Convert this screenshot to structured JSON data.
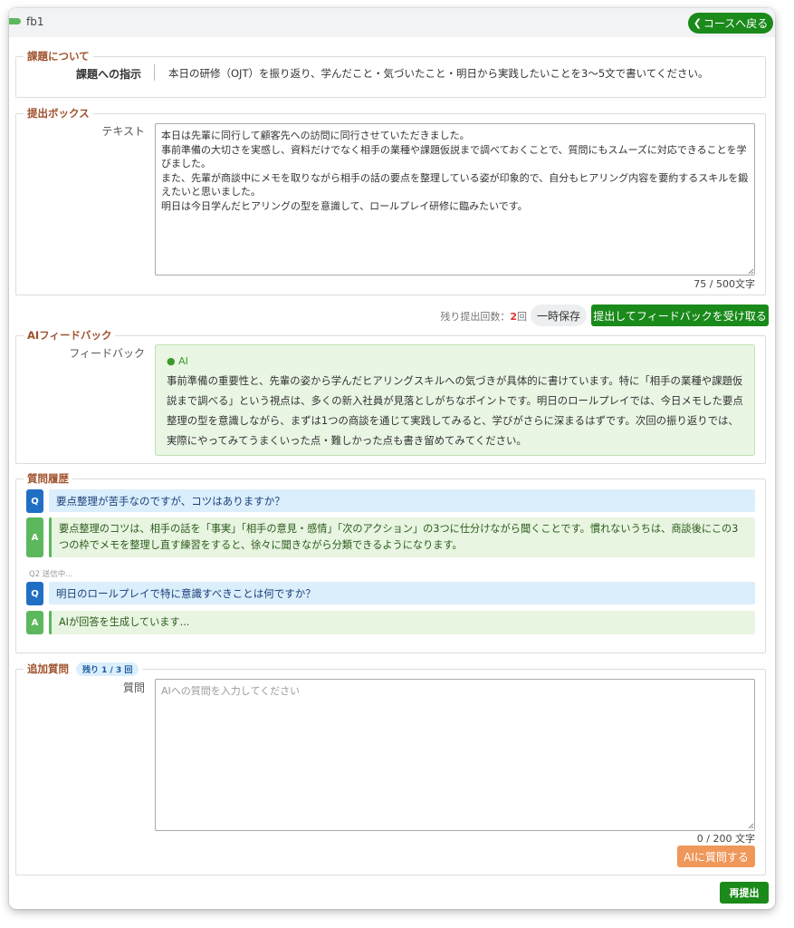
{
  "header": {
    "title": "fb1",
    "back_label": "コースへ戻る"
  },
  "assignment": {
    "legend": "課題について",
    "label": "課題への指示",
    "instruction": "本日の研修（OJT）を振り返り、学んだこと・気づいたこと・明日から実践したいことを3〜5文で書いてください。"
  },
  "submission": {
    "legend": "提出ボックス",
    "label": "テキスト",
    "text": "本日は先輩に同行して顧客先への訪問に同行させていただきました。\n事前準備の大切さを実感し、資料だけでなく相手の業種や課題仮説まで調べておくことで、質問にもスムーズに対応できることを学びました。\nまた、先輩が商談中にメモを取りながら相手の話の要点を整理している姿が印象的で、自分もヒアリング内容を要約するスキルを鍛えたいと思いました。\n明日は今日学んだヒアリングの型を意識して、ロールプレイ研修に臨みたいです。",
    "counter": "75 / 500文字"
  },
  "actions": {
    "remaining_prefix": "残り提出回数：",
    "remaining_count": "2",
    "remaining_suffix": "回",
    "save_draft": "一時保存",
    "submit_feedback": "提出してフィードバックを受け取る"
  },
  "feedback": {
    "legend": "AIフィードバック",
    "label": "フィードバック",
    "source": "AI",
    "text": "事前準備の重要性と、先輩の姿から学んだヒアリングスキルへの気づきが具体的に書けています。特に「相手の業種や課題仮説まで調べる」という視点は、多くの新入社員が見落としがちなポイントです。明日のロールプレイでは、今日メモした要点整理の型を意識しながら、まずは1つの商談を通じて実践してみると、学びがさらに深まるはずです。次回の振り返りでは、実際にやってみてうまくいった点・難しかった点も書き留めてみてください。"
  },
  "history": {
    "legend": "質問履歴",
    "q_badge": "Q",
    "a_badge": "A",
    "items": [
      {
        "question": "要点整理が苦手なのですが、コツはありますか？",
        "answer": "要点整理のコツは、相手の話を「事実」「相手の意見・感情」「次のアクション」の3つに仕分けながら聞くことです。慣れないうちは、商談後にこの3つの枠でメモを整理し直す練習をすると、徐々に聞きながら分類できるようになります。"
      },
      {
        "status": "Q2 送信中...",
        "question": "明日のロールプレイで特に意識すべきことは何ですか？",
        "answer": "AIが回答を生成しています..."
      }
    ]
  },
  "followup": {
    "legend": "追加質問",
    "remaining_badge": "残り 1 / 3 回",
    "label": "質問",
    "placeholder": "AIへの質問を入力してください",
    "counter": "0 / 200 文字",
    "ask_button": "AIに質問する"
  },
  "footer": {
    "resubmit": "再提出"
  },
  "colors": {
    "primary_green": "#1a8a1a",
    "ask_orange": "#f0975a",
    "legend_brown": "#a0522d",
    "q_blue": "#1f6fc5",
    "a_green": "#5cb85c"
  }
}
